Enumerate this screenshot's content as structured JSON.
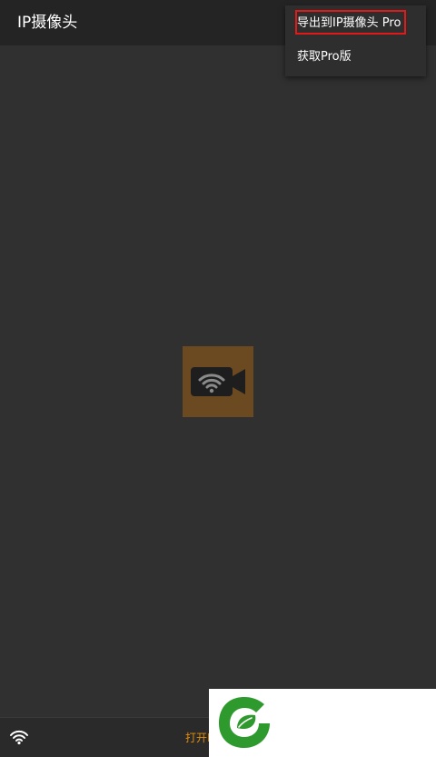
{
  "app_bar": {
    "title": "IP摄像头"
  },
  "overflow_menu": {
    "items": [
      {
        "label": "导出到IP摄像头 Pro",
        "highlighted": true
      },
      {
        "label": "获取Pro版",
        "highlighted": false
      }
    ]
  },
  "bottom_bar": {
    "wifi_icon": "wifi-icon",
    "action_text": "打开I",
    "action_color": "#e08e0b"
  },
  "colors": {
    "background": "#303030",
    "app_bar": "#242424",
    "logo_bg": "#6b4a21",
    "highlight_border": "#e01919",
    "watermark_green": "#2e9a2e"
  },
  "icons": {
    "center_logo": "camera-wifi-icon",
    "watermark": "green-leaf-logo"
  }
}
